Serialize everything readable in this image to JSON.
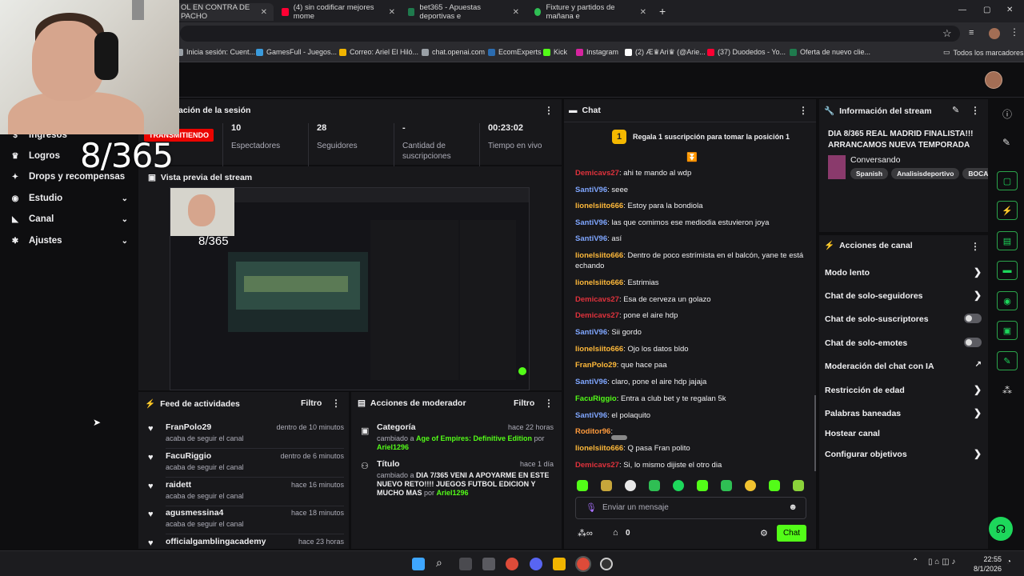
{
  "browser": {
    "tabs": [
      {
        "label": "OL EN CONTRA DE PACHO",
        "color": "#d12c2c"
      },
      {
        "label": "(4) sin codificar mejores mome",
        "color": "#ff0033"
      },
      {
        "label": "bet365 - Apuestas deportivas e",
        "color": "#1f7a4d"
      },
      {
        "label": "Fixture y partidos de mañana e",
        "color": "#2fbf54"
      }
    ],
    "new_tab": "+",
    "window_controls": [
      "—",
      "▢",
      "✕"
    ],
    "bookmarks": [
      {
        "label": "Inicia sesión: Cuent...",
        "color": "#9aa0a6"
      },
      {
        "label": "GamesFull - Juegos...",
        "color": "#3a9bdc"
      },
      {
        "label": "Correo: Ariel El Hiló...",
        "color": "#f0b400"
      },
      {
        "label": "chat.openai.com",
        "color": "#9aa0a6"
      },
      {
        "label": "EcomExperts",
        "color": "#2b6cb0"
      },
      {
        "label": "Kick",
        "color": "#53fc18"
      },
      {
        "label": "Instagram",
        "color": "#d6249f"
      },
      {
        "label": "(2) Æ♛Ari♛ (@Arie...",
        "color": "#ffffff"
      },
      {
        "label": "(37) Duodedos - Yo...",
        "color": "#ff0033"
      },
      {
        "label": "Oferta de nuevo clie...",
        "color": "#1f7a4d"
      }
    ],
    "all_bookmarks": "Todos los marcadores"
  },
  "overlay": {
    "day_counter": "8/365"
  },
  "sidebar": {
    "items": [
      {
        "label": "Ingresos",
        "icon": "money-icon",
        "glyph": "$",
        "chevron": false
      },
      {
        "label": "Logros",
        "icon": "trophy-icon",
        "glyph": "♛",
        "chevron": false
      },
      {
        "label": "Drops y recompensas",
        "icon": "gift-icon",
        "glyph": "✦",
        "chevron": false
      },
      {
        "label": "Estudio",
        "icon": "camera-icon",
        "glyph": "◉",
        "chevron": true
      },
      {
        "label": "Canal",
        "icon": "channel-icon",
        "glyph": "◣",
        "chevron": true
      },
      {
        "label": "Ajustes",
        "icon": "gear-icon",
        "glyph": "✱",
        "chevron": true
      }
    ]
  },
  "session": {
    "title": "ación de la sesión",
    "live_badge": "TRANSMITIENDO",
    "stats": [
      {
        "value": "10",
        "label": "Espectadores"
      },
      {
        "value": "28",
        "label": "Seguidores"
      },
      {
        "value": "-",
        "label": "Cantidad de suscripciones"
      },
      {
        "value": "00:23:02",
        "label": "Tiempo en vivo"
      }
    ]
  },
  "preview": {
    "title": "Vista previa del stream"
  },
  "feed": {
    "title": "Feed de actividades",
    "filter": "Filtro",
    "items": [
      {
        "name": "FranPolo29",
        "sub": "acaba de seguir el canal",
        "time": "dentro de 10 minutos"
      },
      {
        "name": "FacuRiggio",
        "sub": "acaba de seguir el canal",
        "time": "dentro de 6 minutos"
      },
      {
        "name": "raidett",
        "sub": "acaba de seguir el canal",
        "time": "hace 16 minutos"
      },
      {
        "name": "agusmessina4",
        "sub": "acaba de seguir el canal",
        "time": "hace 18 minutos"
      },
      {
        "name": "officialgamblingacademy",
        "sub": "",
        "time": "hace 23 horas"
      }
    ]
  },
  "mod": {
    "title": "Acciones de moderador",
    "filter": "Filtro",
    "items": [
      {
        "type": "Categoría",
        "time": "hace 22 horas",
        "pre": "cambiado a ",
        "value": "Age of Empires: Definitive Edition",
        "by": " por ",
        "user": "Ariel1296"
      },
      {
        "type": "Título",
        "time": "hace 1 día",
        "pre": "cambiado a ",
        "value": "DIA 7/365 VENI A APOYARME EN ESTE NUEVO RETO!!!! JUEGOS FUTBOL EDICION Y MUCHO MAS",
        "by": " por ",
        "user": "Ariel1296"
      }
    ]
  },
  "chat": {
    "title": "Chat",
    "pinned_rank": "1",
    "pinned_text": "Regala 1 suscripción para tomar la posición 1",
    "messages": [
      {
        "user": "Demicavs27",
        "color": "#e0323c",
        "text": "ahi te mando al wdp"
      },
      {
        "user": "SantiV96",
        "color": "#7fa6ff",
        "text": "seee"
      },
      {
        "user": "lionelsiito666",
        "color": "#ffb93a",
        "text": "Estoy para la bondiola"
      },
      {
        "user": "SantiV96",
        "color": "#7fa6ff",
        "text": "las que comimos ese mediodia estuvieron joya"
      },
      {
        "user": "SantiV96",
        "color": "#7fa6ff",
        "text": "así"
      },
      {
        "user": "lionelsiito666",
        "color": "#ffb93a",
        "text": "Dentro de poco estrímista en el balcón, yane te está echando"
      },
      {
        "user": "lionelsiito666",
        "color": "#ffb93a",
        "text": "Estrimias"
      },
      {
        "user": "Demicavs27",
        "color": "#e0323c",
        "text": "Esa de cerveza un golazo"
      },
      {
        "user": "Demicavs27",
        "color": "#e0323c",
        "text": "pone el aire hdp"
      },
      {
        "user": "SantiV96",
        "color": "#7fa6ff",
        "text": "Sii gordo"
      },
      {
        "user": "lionelsiito666",
        "color": "#ffb93a",
        "text": "Ojo los datos bldo"
      },
      {
        "user": "FranPolo29",
        "color": "#ffb93a",
        "text": "que hace paa"
      },
      {
        "user": "SantiV96",
        "color": "#7fa6ff",
        "text": "claro, pone el aire hdp jajaja"
      },
      {
        "user": "FacuRiggio",
        "color": "#53fc18",
        "text": "Entra a club bet y te regalan 5k"
      },
      {
        "user": "SantiV96",
        "color": "#7fa6ff",
        "text": "el polaquito"
      },
      {
        "user": "Roditor96",
        "color": "#ff9a3c",
        "text": ""
      },
      {
        "user": "lionelsiito666",
        "color": "#ffb93a",
        "text": "Q pasa Fran polito"
      },
      {
        "user": "Demicavs27",
        "color": "#e0323c",
        "text": "Si, lo mismo dijiste el otro dia"
      }
    ],
    "placeholder": "Enviar un mensaje",
    "points": "0",
    "send": "Chat"
  },
  "info": {
    "title": "Información del stream",
    "stream_title": "DIA 8/365 REAL MADRID FINALISTA!!! ARRANCAMOS NUEVA TEMPORADA DE...",
    "category": "Conversando",
    "tags": [
      "Spanish",
      "Analisisdeportivo",
      "BOCA,"
    ]
  },
  "actions": {
    "title": "Acciones de canal",
    "items": [
      {
        "label": "Modo lento",
        "control": "arrow"
      },
      {
        "label": "Chat de solo-seguidores",
        "control": "arrow"
      },
      {
        "label": "Chat de solo-suscriptores",
        "control": "toggle"
      },
      {
        "label": "Chat de solo-emotes",
        "control": "toggle"
      },
      {
        "label": "Moderación del chat con IA",
        "control": "external"
      },
      {
        "label": "Restricción de edad",
        "control": "arrow"
      },
      {
        "label": "Palabras baneadas",
        "control": "arrow"
      },
      {
        "label": "Hostear canal",
        "control": "none"
      },
      {
        "label": "Configurar objetivos",
        "control": "arrow"
      }
    ]
  },
  "taskbar": {
    "time": "22:55",
    "date": "8/1/2026"
  },
  "colors": {
    "accent": "#53fc18",
    "live": "#eb0400",
    "panel": "#18181b"
  }
}
